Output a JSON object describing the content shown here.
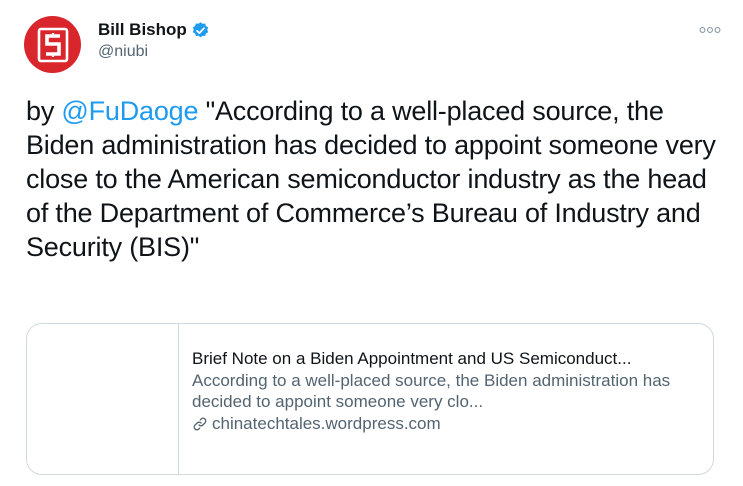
{
  "author": {
    "display_name": "Bill Bishop",
    "handle": "@niubi",
    "verified": true
  },
  "tweet": {
    "prefix": "by ",
    "mention": "@FuDaoge",
    "body": " \"According to a well-placed source, the Biden administration has decided to appoint someone very close to the American semiconductor industry as the head of the Department of Commerce’s Bureau of Industry and Security (BIS)\""
  },
  "card": {
    "title": "Brief Note on a Biden Appointment and US Semiconduct...",
    "description": "According to a well-placed source, the Biden administration has decided to appoint someone very clo...",
    "domain": "chinatechtales.wordpress.com"
  },
  "icons": {
    "avatar": "red-s-logo-avatar",
    "verified": "verified-badge-icon",
    "more": "more-options-icon",
    "link": "link-icon"
  },
  "colors": {
    "accent": "#1d9bf0",
    "avatar_red": "#d8262c",
    "text_primary": "#0f1419",
    "text_secondary": "#536471",
    "border": "#cfd9de"
  }
}
